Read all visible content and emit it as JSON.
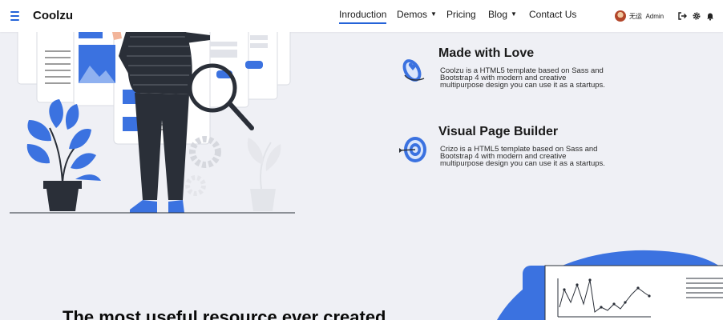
{
  "brand": {
    "name": "Coolzu"
  },
  "nav": {
    "items": [
      {
        "label": "Inroduction",
        "active": true
      },
      {
        "label": "Demos",
        "dropdown": true
      },
      {
        "label": "Pricing"
      },
      {
        "label": "Blog",
        "dropdown": true
      },
      {
        "label": "Contact Us"
      }
    ]
  },
  "user": {
    "name": "无运",
    "role": "Admin"
  },
  "toolbar_icons": [
    "logout-icon",
    "settings-icon",
    "bell-icon"
  ],
  "features": [
    {
      "icon": "hand-heart-icon",
      "title": "Made with Love",
      "description": "Coolzu is a HTML5 template based on Sass and Bootstrap 4 with modern and creative multipurpose design you can use it as a startups."
    },
    {
      "icon": "target-icon",
      "title": "Visual Page Builder",
      "description": "Crizo is a HTML5 template based on Sass and Bootstrap 4 with modern and creative multipurpose design you can use it as a startups."
    }
  ],
  "bottom": {
    "heading": "The most useful resource ever created"
  },
  "colors": {
    "accent": "#2563d8",
    "background": "#eff0f5",
    "dark": "#2a2f38"
  }
}
